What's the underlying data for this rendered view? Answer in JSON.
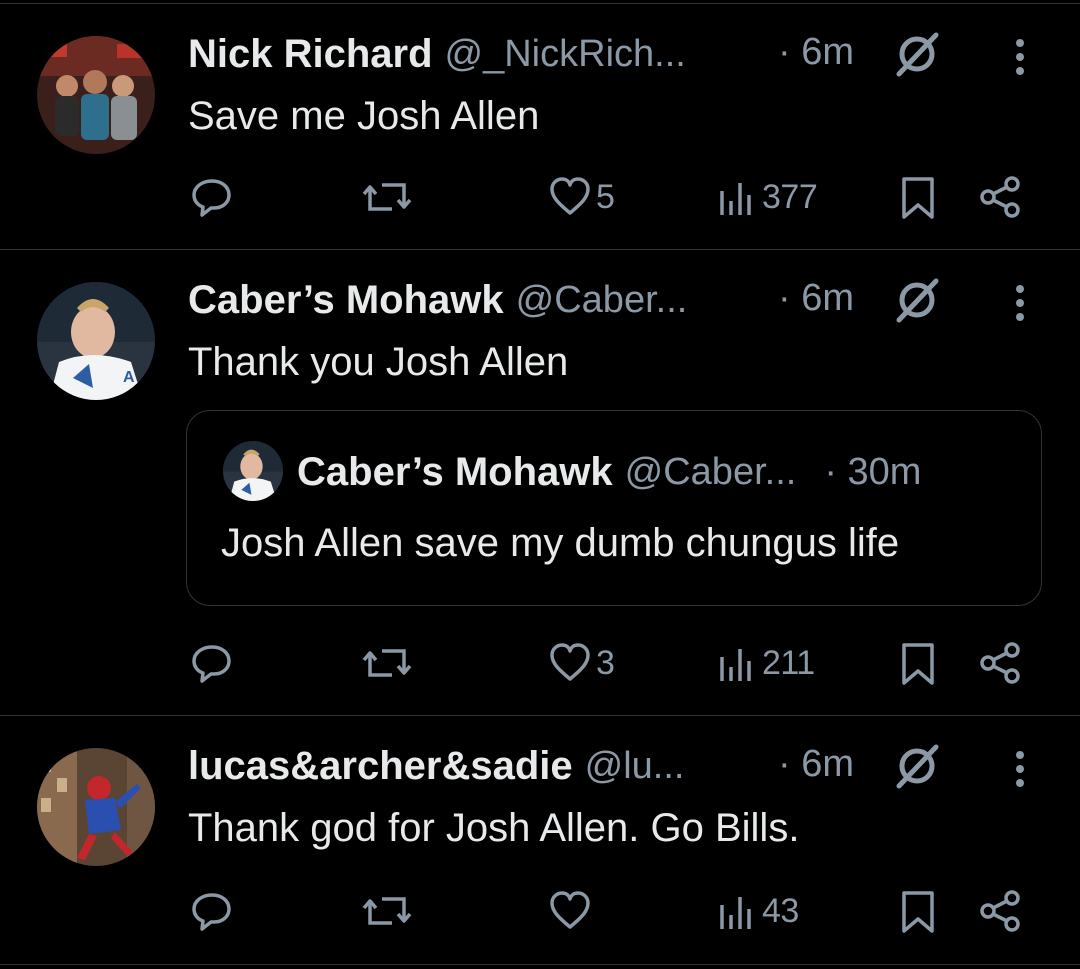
{
  "tweets": [
    {
      "name": "Nick Richard",
      "handle": "@_NickRich...",
      "time": "· 6m",
      "text": "Save me Josh Allen",
      "likes": "5",
      "views": "377"
    },
    {
      "name": "Caber’s Mohawk",
      "handle": "@Caber...",
      "time": "· 6m",
      "text": "Thank you Josh Allen",
      "likes": "3",
      "views": "211",
      "quote": {
        "name": "Caber’s Mohawk",
        "handle": "@Caber...",
        "time": "· 30m",
        "text": "Josh Allen save my dumb chungus life"
      }
    },
    {
      "name": "lucas&archer&sadie",
      "handle": "@lu...",
      "time": "· 6m",
      "text": "Thank god for Josh Allen. Go Bills.",
      "likes": "",
      "views": "43"
    }
  ],
  "colors": {
    "background": "#000000",
    "text": "#e7e9ea",
    "secondary": "#8b98a5",
    "divider": "#2f3336"
  },
  "icons": [
    "reply-icon",
    "retweet-icon",
    "heart-icon",
    "views-icon",
    "bookmark-icon",
    "share-icon",
    "mute-icon",
    "more-icon"
  ]
}
